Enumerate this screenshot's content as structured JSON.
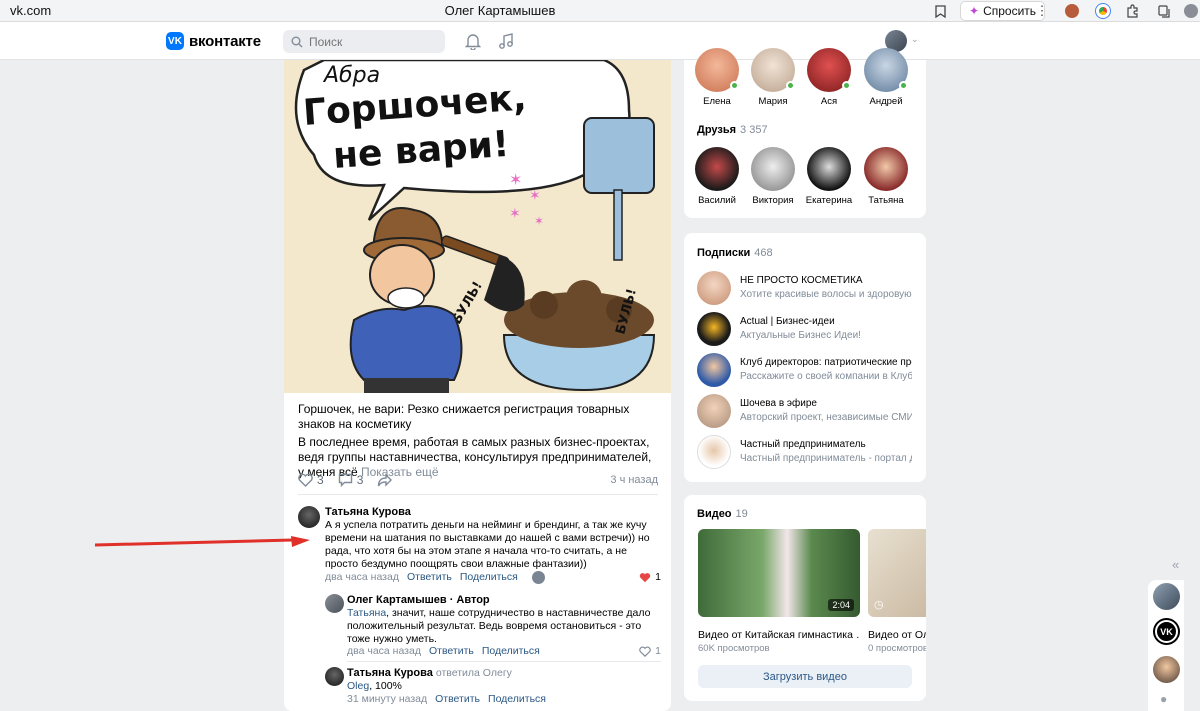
{
  "browser": {
    "url": "vk.com",
    "window_title": "Олег Картамышев",
    "ask_button": "Спросить"
  },
  "header": {
    "logo_text": "вконтакте",
    "logo_mark": "VK",
    "search_placeholder": "Поиск"
  },
  "post": {
    "image_text_line1": "Горшочек,",
    "image_text_line2": "не вари!",
    "image_text_top": "Абра",
    "image_sfx_left": "БУЛЬ!",
    "image_sfx_right": "БУЛЬ!",
    "title": "Горшочек, не вари: Резко снижается регистрация товарных знаков на косметику",
    "body": "В последнее время, работая в самых разных бизнес-проектах, ведя группы наставничества, консультируя предпринимателей, у меня всё",
    "show_more": "Показать ещё",
    "likes": "3",
    "comments": "3",
    "time": "3 ч назад"
  },
  "comments": [
    {
      "author": "Татьяна Курова",
      "text": "А я успела потратить деньги на нейминг и брендинг, а так же кучу времени на шатания по выставками до нашей с вами встречи)) но рада, что хотя бы на этом этапе я начала что-то считать, а не просто бездумно поощрять свои влажные фантазии))",
      "time": "два часа назад",
      "reply": "Ответить",
      "share": "Поделиться",
      "likes": "1"
    },
    {
      "author": "Олег Картамышев · Автор",
      "mention": "Татьяна",
      "text": ", значит, наше сотрудничество в наставничестве дало положительный результат. Ведь вовремя остановиться - это тоже нужно уметь.",
      "time": "два часа назад",
      "reply": "Ответить",
      "share": "Поделиться",
      "likes": "1"
    },
    {
      "author": "Татьяна Курова",
      "replied_to": "ответила Олегу",
      "mention": "Oleg",
      "text": ", 100%",
      "time": "31 минуту назад",
      "reply": "Ответить",
      "share": "Поделиться"
    }
  ],
  "online_friends": [
    {
      "name": "Елена"
    },
    {
      "name": "Мария"
    },
    {
      "name": "Ася"
    },
    {
      "name": "Андрей"
    }
  ],
  "friends": {
    "title": "Друзья",
    "count": "3 357",
    "items": [
      {
        "name": "Василий"
      },
      {
        "name": "Виктория"
      },
      {
        "name": "Екатерина"
      },
      {
        "name": "Татьяна"
      }
    ]
  },
  "subscriptions": {
    "title": "Подписки",
    "count": "468",
    "items": [
      {
        "name": "НЕ ПРОСТО КОСМЕТИКА",
        "desc": "Хотите красивые волосы и здоровую …"
      },
      {
        "name": "Actual | Бизнес-идеи",
        "desc": "Актуальные Бизнес Идеи!"
      },
      {
        "name": "Клуб директоров: патриотические пре…",
        "desc": "Расскажите о своей компании в Клуб…"
      },
      {
        "name": "Шочева в эфире",
        "desc": "Авторский проект, независимые СМИ"
      },
      {
        "name": "Частный предприниматель",
        "desc": "Частный предприниматель - портал д…"
      }
    ]
  },
  "videos": {
    "title": "Видео",
    "count": "19",
    "items": [
      {
        "name": "Видео от Китайская гимнастика …",
        "views": "60K просмотров",
        "duration": "2:04"
      },
      {
        "name": "Видео от Оле",
        "views": "0 просмотров",
        "duration": ""
      }
    ],
    "upload": "Загрузить видео"
  },
  "colors": {
    "accent": "#0077ff",
    "link": "#2a5885",
    "online": "#4bb34b",
    "like_red": "#e64646",
    "annotation_arrow": "#e0302a"
  }
}
